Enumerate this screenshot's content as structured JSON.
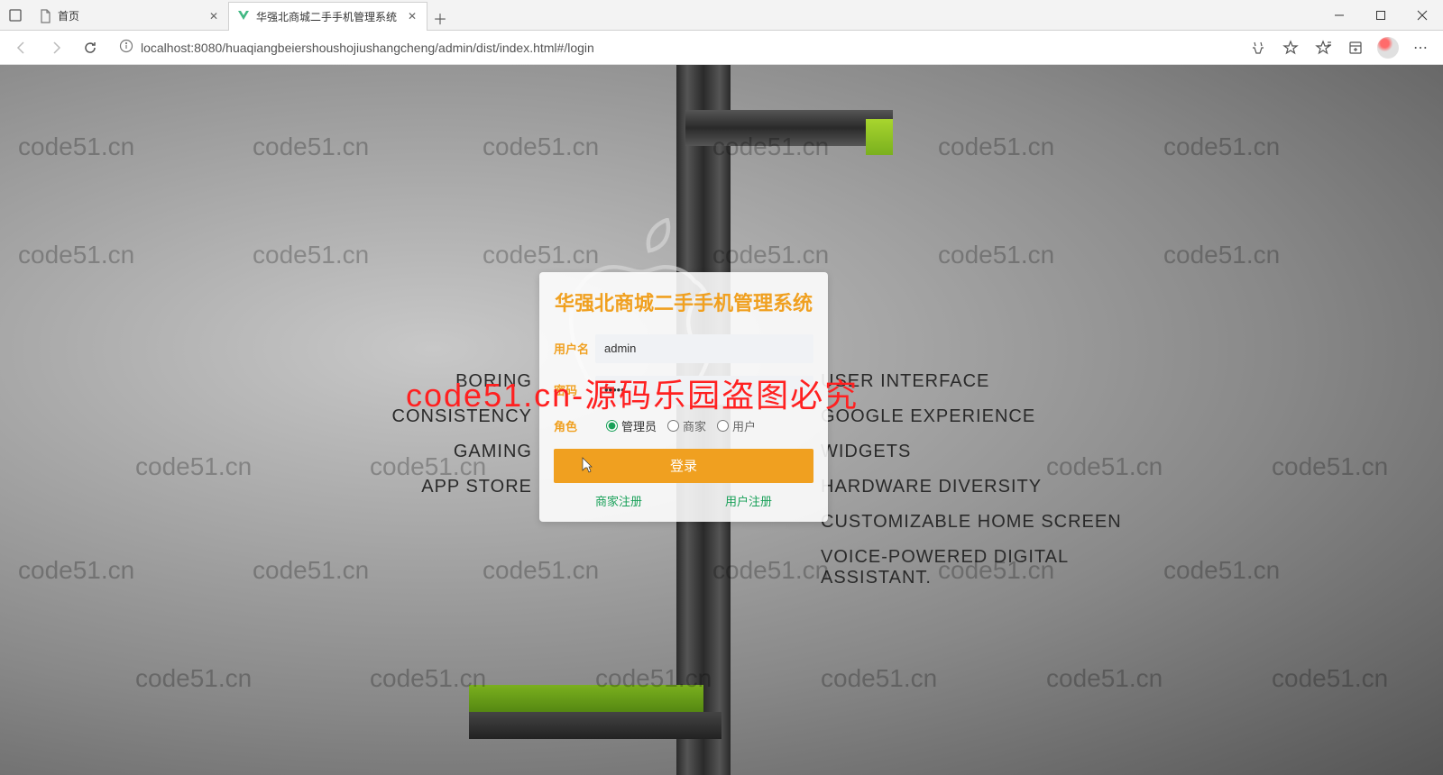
{
  "browser": {
    "tab1_title": "首页",
    "tab2_title": "华强北商城二手手机管理系统",
    "url": "localhost:8080/huaqiangbeiershoushojiushangcheng/admin/dist/index.html#/login"
  },
  "watermark": "code51.cn",
  "red_overlay": "code51.cn-源码乐园盗图必究",
  "side_left": [
    "BORING",
    "CONSISTENCY",
    "GAMING",
    "APP STORE"
  ],
  "side_right": [
    "USER INTERFACE",
    "GOOGLE EXPERIENCE",
    "WIDGETS",
    "HARDWARE DIVERSITY",
    "CUSTOMIZABLE HOME SCREEN",
    "VOICE-POWERED DIGITAL ASSISTANT."
  ],
  "login": {
    "title": "华强北商城二手手机管理系统",
    "username_label": "用户名",
    "username_value": "admin",
    "password_label": "密码",
    "password_value": "•••••",
    "role_label": "角色",
    "roles": {
      "admin": "管理员",
      "merchant": "商家",
      "user": "用户"
    },
    "selected_role": "admin",
    "login_btn": "登录",
    "merchant_reg": "商家注册",
    "user_reg": "用户注册"
  }
}
